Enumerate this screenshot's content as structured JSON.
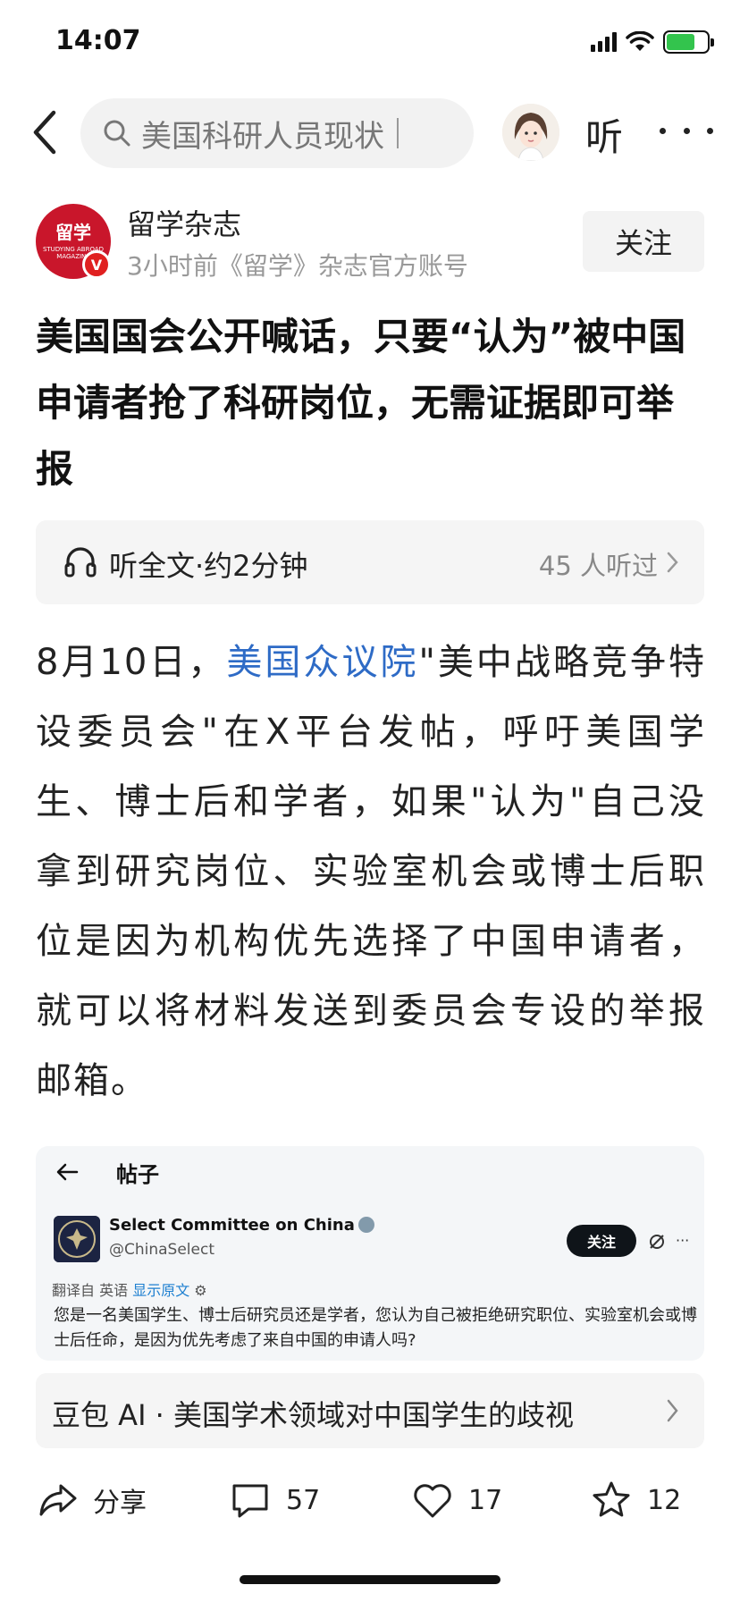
{
  "status_bar": {
    "time": "14:07"
  },
  "nav": {
    "search_text": "美国科研人员现状",
    "listen_label": "听"
  },
  "author": {
    "logo_text": "留学",
    "logo_sub": "STUDYING ABROAD MAGAZINE",
    "verified_mark": "V",
    "name": "留学杂志",
    "meta": "3小时前《留学》杂志官方账号",
    "follow_label": "关注"
  },
  "article": {
    "title": "美国国会公开喊话，只要“认为”被中国申请者抢了科研岗位，无需证据即可举报",
    "listen_bar": {
      "text": "听全文·约2分钟",
      "count": "45 人听过"
    },
    "paragraph": {
      "prefix": "8月10日，",
      "link": "美国众议院",
      "rest": "\"美中战略竞争特设委员会\"在X平台发帖，呼吁美国学生、博士后和学者，如果\"认为\"自己没拿到研究岗位、实验室机会或博士后职位是因为机构优先选择了中国申请者，就可以将材料发送到委员会专设的举报邮箱。"
    }
  },
  "embed": {
    "header_title": "帖子",
    "account_name": "Select Committee on China",
    "account_handle": "@ChinaSelect",
    "follow_label": "关注",
    "more": "···",
    "translate_prefix": "翻译自 英语",
    "translate_link": "显示原文",
    "content": "您是一名美国学生、博士后研究员还是学者，您认为自己被拒绝研究职位、实验室机会或博士后任命，是因为优先考虑了来自中国的申请人吗?"
  },
  "ai_bar": {
    "text": "豆包 AI · 美国学术领域对中国学生的歧视"
  },
  "actions": {
    "share_label": "分享",
    "comment_count": "57",
    "like_count": "17",
    "favorite_count": "12"
  },
  "colors": {
    "link_blue": "#2e6bc6",
    "brand_red": "#c9162b",
    "battery_green": "#33c44d"
  }
}
